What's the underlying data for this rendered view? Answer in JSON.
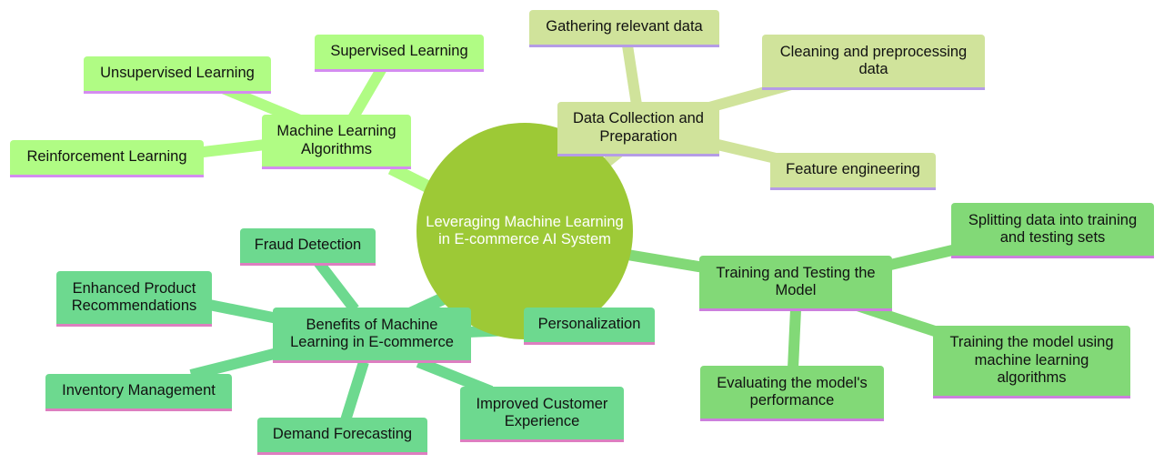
{
  "root": {
    "label": "Leveraging Machine Learning in E-commerce AI System",
    "color": "#9dc936"
  },
  "branches": [
    {
      "id": "ml",
      "label": "Machine Learning Algorithms",
      "color": "#b0fc84",
      "children": [
        "Supervised Learning",
        "Unsupervised Learning",
        "Reinforcement Learning"
      ]
    },
    {
      "id": "dc",
      "label": "Data Collection and Preparation",
      "color": "#d0e39b",
      "children": [
        "Gathering relevant data",
        "Cleaning and preprocessing data",
        "Feature engineering"
      ]
    },
    {
      "id": "tt",
      "label": "Training and Testing the Model",
      "color": "#82d977",
      "children": [
        "Splitting data into training and testing sets",
        "Training the model using machine learning algorithms",
        "Evaluating the model's performance"
      ]
    },
    {
      "id": "bn",
      "label": "Benefits of Machine Learning in E-commerce",
      "color": "#6dd98f",
      "children": [
        "Personalization",
        "Improved Customer Experience",
        "Demand Forecasting",
        "Inventory Management",
        "Enhanced Product Recommendations",
        "Fraud Detection"
      ]
    }
  ]
}
